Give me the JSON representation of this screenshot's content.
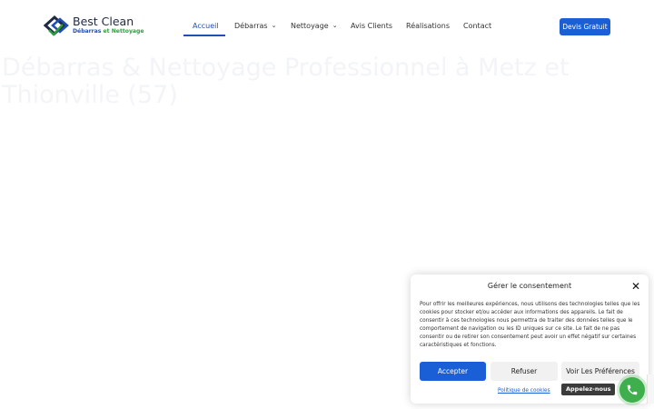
{
  "brand": {
    "name": "Best Clean",
    "tagline_part1": "Débarras",
    "tagline_part2": " et Nettoyage",
    "colors": {
      "blue": "#1f4fb3",
      "green": "#2c9e3f"
    }
  },
  "nav": {
    "items": [
      {
        "label": "Accueil",
        "active": true,
        "dropdown": false
      },
      {
        "label": "Débarras",
        "active": false,
        "dropdown": true
      },
      {
        "label": "Nettoyage",
        "active": false,
        "dropdown": true
      },
      {
        "label": "Avis Clients",
        "active": false,
        "dropdown": false
      },
      {
        "label": "Réalisations",
        "active": false,
        "dropdown": false
      },
      {
        "label": "Contact",
        "active": false,
        "dropdown": false
      }
    ],
    "cta": "Devis Gratuit"
  },
  "hero": {
    "title": "Débarras & Nettoyage Professionnel à Metz et Thionville (57)"
  },
  "consent": {
    "title": "Gérer le consentement",
    "body": "Pour offrir les meilleures expériences, nous utilisons des technologies telles que les cookies pour stocker et/ou accéder aux informations des appareils. Le fait de consentir à ces technologies nous permettra de traiter des données telles que le comportement de navigation ou les ID uniques sur ce site. Le fait de ne pas consentir ou de retirer son consentement peut avoir un effet négatif sur certaines caractéristiques et fonctions.",
    "accept": "Accepter",
    "refuse": "Refuser",
    "preferences": "Voir Les Préférences",
    "policy": "Politique de cookies"
  },
  "call": {
    "label": "Appelez-nous",
    "icon": "phone-icon"
  },
  "colors": {
    "accent": "#1a5fd6",
    "call_green": "#3fae4d"
  }
}
